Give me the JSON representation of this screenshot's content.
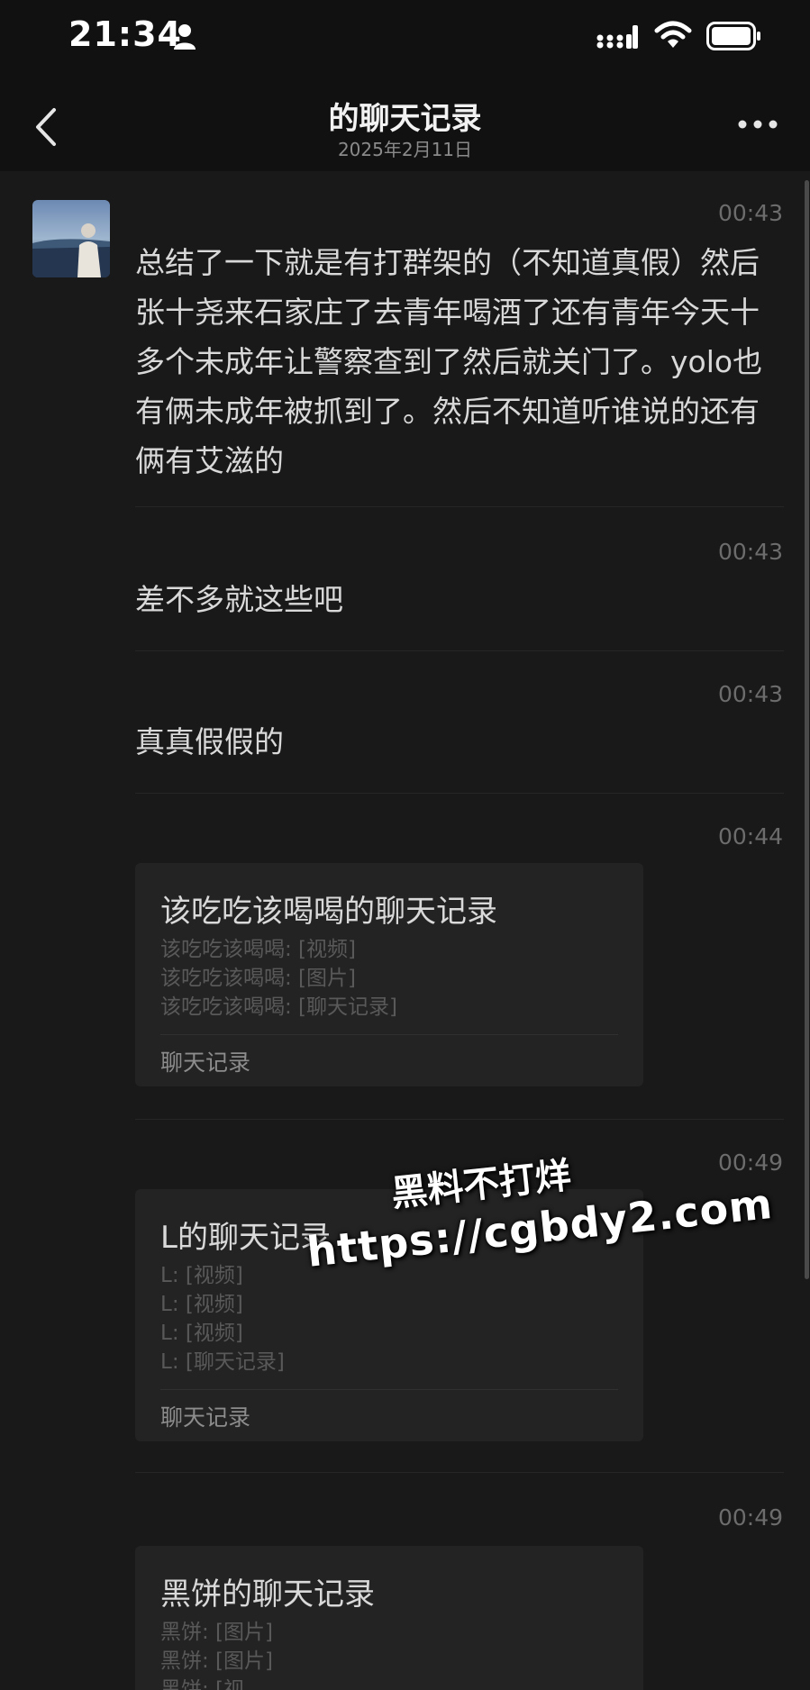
{
  "status_bar": {
    "time": "21:34"
  },
  "header": {
    "title": "的聊天记录",
    "subtitle": "2025年2月11日"
  },
  "messages": [
    {
      "time": "00:43",
      "text": "总结了一下就是有打群架的（不知道真假）然后张十尧来石家庄了去青年喝酒了还有青年今天十多个未成年让警察查到了然后就关门了。yolo也有俩未成年被抓到了。然后不知道听谁说的还有俩有艾滋的"
    },
    {
      "time": "00:43",
      "text": "差不多就这些吧"
    },
    {
      "time": "00:43",
      "text": "真真假假的"
    }
  ],
  "cards": [
    {
      "time": "00:44",
      "title": "该吃吃该喝喝的聊天记录",
      "lines": [
        "该吃吃该喝喝: [视频]",
        "该吃吃该喝喝: [图片]",
        "该吃吃该喝喝: [聊天记录]"
      ],
      "footer": "聊天记录"
    },
    {
      "time": "00:49",
      "title": "L的聊天记录",
      "lines": [
        "L: [视频]",
        "L: [视频]",
        "L: [视频]",
        "L: [聊天记录]"
      ],
      "footer": "聊天记录"
    },
    {
      "time": "00:49",
      "title": "黑饼的聊天记录",
      "lines": [
        "黑饼: [图片]",
        "黑饼: [图片]",
        "黑饼: [视"
      ],
      "footer": ""
    }
  ],
  "watermark": {
    "line1": "黑料不打烊",
    "line2": "https://cgbdy2.com"
  },
  "icons": [
    "person-icon",
    "signal-icon",
    "wifi-icon",
    "battery-icon",
    "back-icon",
    "more-icon"
  ]
}
